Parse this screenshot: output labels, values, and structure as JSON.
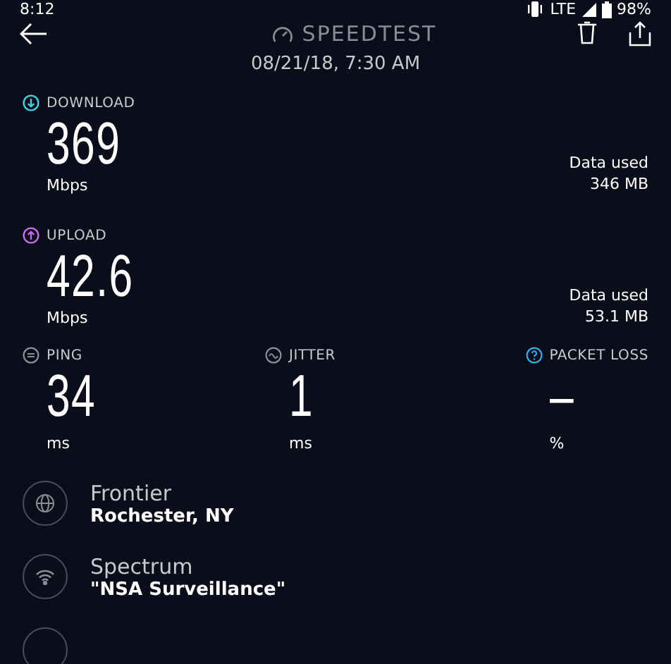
{
  "status_bar": {
    "time": "8:12",
    "network": "LTE",
    "battery": "98%"
  },
  "header": {
    "title": "SPEEDTEST",
    "date": "08/21/18, 7:30 AM"
  },
  "speeds": [
    {
      "kind": "download",
      "label": "DOWNLOAD",
      "value": "369",
      "unit": "Mbps",
      "data_label": "Data used",
      "data_value": "346 MB",
      "color": "#3fd0e0"
    },
    {
      "kind": "upload",
      "label": "UPLOAD",
      "value": "42.6",
      "unit": "Mbps",
      "data_label": "Data used",
      "data_value": "53.1 MB",
      "color": "#c26ee8"
    }
  ],
  "stats": [
    {
      "kind": "ping",
      "label": "PING",
      "value": "34",
      "unit": "ms"
    },
    {
      "kind": "jitter",
      "label": "JITTER",
      "value": "1",
      "unit": "ms"
    },
    {
      "kind": "packet_loss",
      "label": "PACKET LOSS",
      "value": "–",
      "unit": "%"
    }
  ],
  "details": [
    {
      "kind": "isp",
      "title": "Frontier",
      "subtitle": "Rochester, NY"
    },
    {
      "kind": "wifi",
      "title": "Spectrum",
      "subtitle": "\"NSA Surveillance\""
    },
    {
      "kind": "server"
    }
  ]
}
